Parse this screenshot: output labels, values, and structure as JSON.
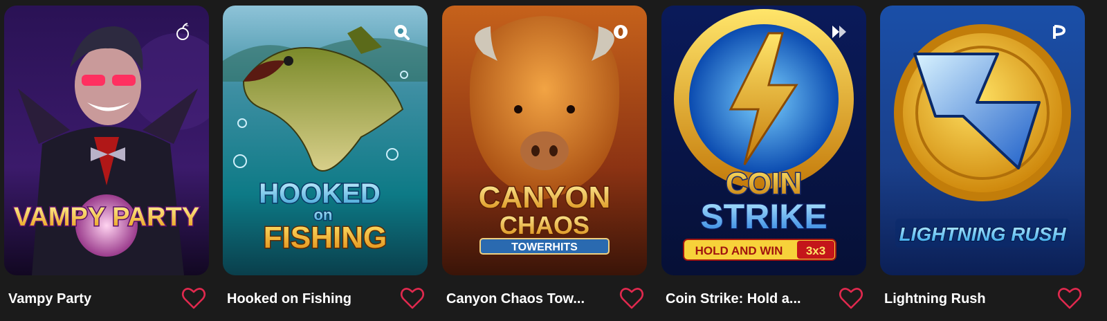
{
  "games": [
    {
      "title": "Vampy Party",
      "logo_text": [
        "VAMPY PARTY"
      ],
      "provider_icon": "pragmatic-cherry-icon"
    },
    {
      "title": "Hooked on Fishing",
      "logo_text": [
        "HOOKED",
        "on",
        "FISHING"
      ],
      "provider_icon": "provider-q-icon"
    },
    {
      "title": "Canyon Chaos Tow...",
      "logo_text": [
        "CANYON",
        "CHAOS",
        "TOWERHITS"
      ],
      "provider_icon": "provider-ring-icon"
    },
    {
      "title": "Coin Strike: Hold a...",
      "logo_text": [
        "COIN",
        "STRIKE",
        "HOLD AND WIN",
        "3x3"
      ],
      "provider_icon": "provider-triangles-icon"
    },
    {
      "title": "Lightning Rush",
      "logo_text": [
        "LIGHTNING RUSH"
      ],
      "provider_icon": "provider-p-icon"
    }
  ],
  "favorite_icon": "heart-outline-icon",
  "colors": {
    "background": "#1b1b1b",
    "heart": "#e0294e",
    "caption": "#ffffff"
  }
}
